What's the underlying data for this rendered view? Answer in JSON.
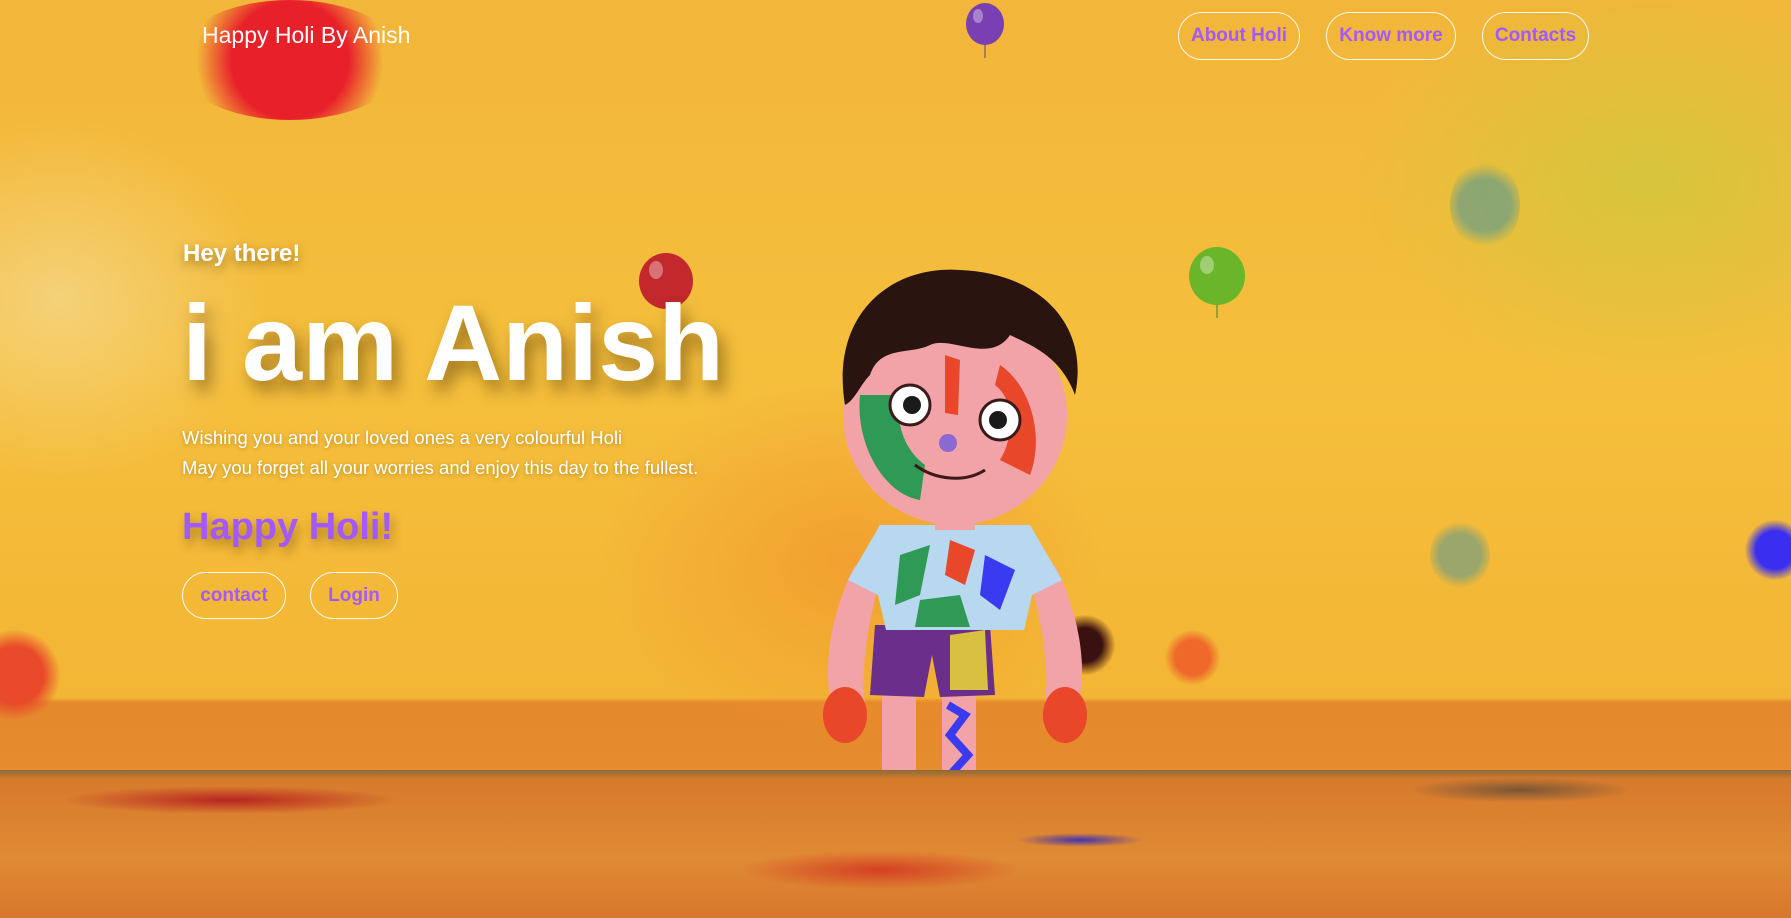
{
  "header": {
    "brand": "Happy Holi By Anish",
    "nav": [
      {
        "label": "About Holi"
      },
      {
        "label": "Know more"
      },
      {
        "label": "Contacts"
      }
    ]
  },
  "hero": {
    "greeting": "Hey there!",
    "headline": "i am Anish",
    "message_line_1": "Wishing you and your loved ones a very colourful Holi",
    "message_line_2": "May you forget all your worries and enjoy this day to the fullest.",
    "wish": "Happy Holi!",
    "buttons": [
      {
        "label": "contact"
      },
      {
        "label": "Login"
      }
    ]
  },
  "colors": {
    "accent": "#a259ff",
    "text": "#ffffff",
    "background": "#f4b83a"
  }
}
